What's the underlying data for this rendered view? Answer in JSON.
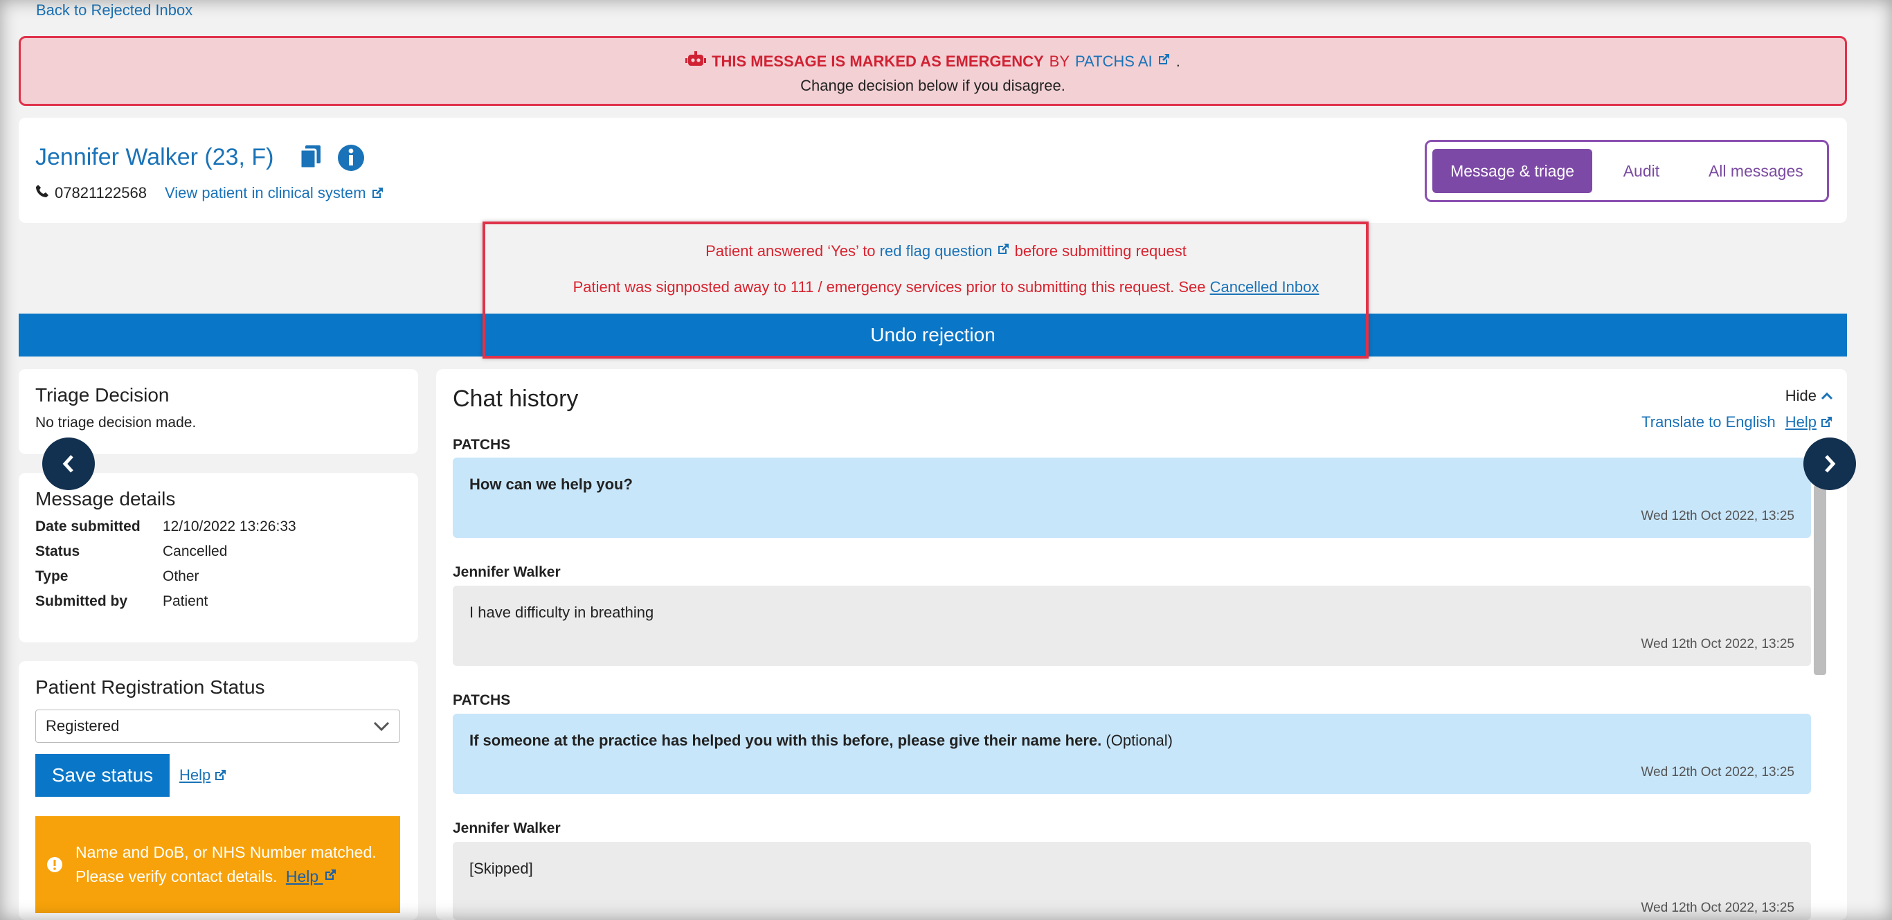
{
  "nav": {
    "back_label": "Back to Rejected Inbox"
  },
  "emergency": {
    "headline": "THIS MESSAGE IS MARKED AS EMERGENCY",
    "by": "BY",
    "source": "PATCHS AI",
    "period": ".",
    "subtext": "Change decision below if you disagree."
  },
  "patient": {
    "name": "Jennifer Walker (23, F)",
    "phone": "07821122568",
    "clinical_link": "View patient in clinical system"
  },
  "tabs": [
    {
      "label": "Message & triage",
      "active": true
    },
    {
      "label": "Audit"
    },
    {
      "label": "All messages"
    }
  ],
  "notes": {
    "n1_pre": "Patient answered ‘Yes’ to",
    "n1_link": "red flag question",
    "n1_post": "before submitting request",
    "n2_pre": "Patient was signposted away to 111 / emergency services prior to submitting this request. See",
    "n2_link": "Cancelled Inbox"
  },
  "undo_label": "Undo rejection",
  "triage": {
    "title": "Triage Decision",
    "text": "No triage decision made."
  },
  "message_details": {
    "title": "Message details",
    "rows": [
      {
        "k": "Date submitted",
        "v": "12/10/2022 13:26:33"
      },
      {
        "k": "Status",
        "v": "Cancelled"
      },
      {
        "k": "Type",
        "v": "Other"
      },
      {
        "k": "Submitted by",
        "v": "Patient"
      }
    ]
  },
  "registration": {
    "title": "Patient Registration Status",
    "selected": "Registered",
    "save_label": "Save status",
    "help_label": "Help",
    "warning": "Name and DoB, or NHS Number matched. Please verify contact details.",
    "warning_help": "Help"
  },
  "chat": {
    "title": "Chat history",
    "hide_label": "Hide",
    "translate_label": "Translate to English",
    "help_label": "Help",
    "messages": [
      {
        "sender": "PATCHS",
        "text": "How can we help you?",
        "bold": true,
        "time": "Wed 12th Oct 2022, 13:25",
        "style": "blue"
      },
      {
        "sender": "Jennifer Walker",
        "text": "I have difficulty in breathing",
        "time": "Wed 12th Oct 2022, 13:25",
        "style": "grey"
      },
      {
        "sender": "PATCHS",
        "text": "If someone at the practice has helped you with this before, please give their name here.",
        "suffix": "(Optional)",
        "bold": true,
        "time": "Wed 12th Oct 2022, 13:25",
        "style": "blue"
      },
      {
        "sender": "Jennifer Walker",
        "text": "[Skipped]",
        "time": "Wed 12th Oct 2022, 13:25",
        "style": "grey"
      }
    ]
  },
  "colors": {
    "accent": "#0a76c7",
    "emergency": "#e0324a",
    "purple": "#7d49a6",
    "warning": "#f7a20a"
  }
}
